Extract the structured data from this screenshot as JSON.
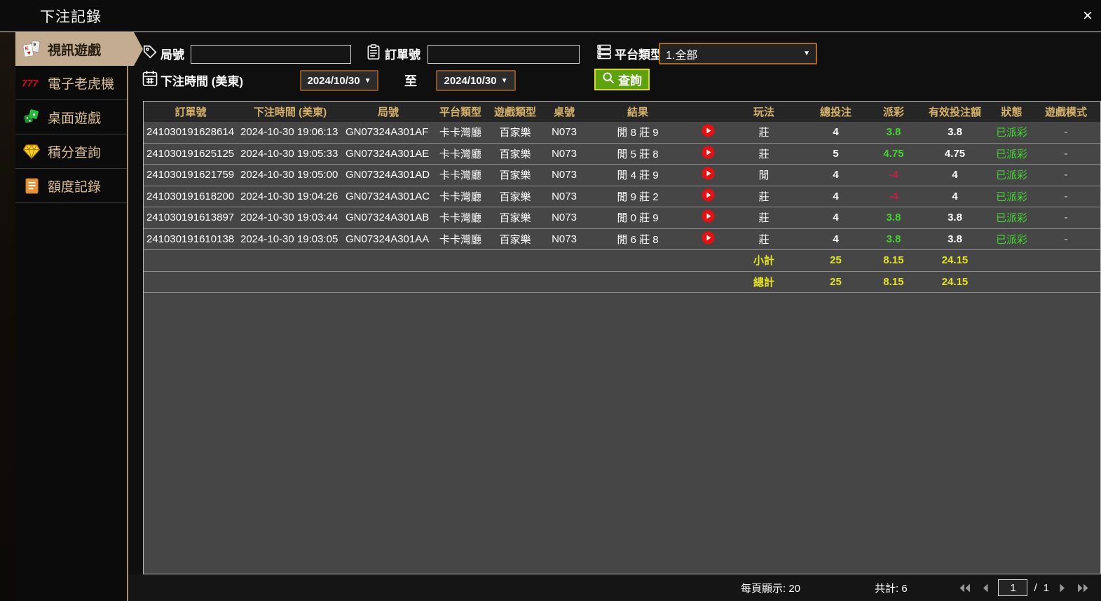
{
  "window": {
    "title": "下注記錄",
    "close_icon": "×"
  },
  "sidebar": {
    "items": [
      {
        "label": "視訊遊戲",
        "icon": "playing-cards-icon",
        "selected": true
      },
      {
        "label": "電子老虎機",
        "icon": "slot-777-icon",
        "selected": false
      },
      {
        "label": "桌面遊戲",
        "icon": "dice-icon",
        "selected": false
      },
      {
        "label": "積分查詢",
        "icon": "gem-icon",
        "selected": false
      },
      {
        "label": "額度記錄",
        "icon": "document-icon",
        "selected": false
      }
    ]
  },
  "filters": {
    "round_label": "局號",
    "order_label": "訂單號",
    "platform_label": "平台類型",
    "platform_value": "1.全部",
    "time_label": "下注時間 (美東)",
    "date_from": "2024/10/30",
    "date_to": "2024/10/30",
    "to_label": "至",
    "search_label": "查詢",
    "caret": "▼"
  },
  "table": {
    "columns": [
      "訂單號",
      "下注時間 (美東)",
      "局號",
      "平台類型",
      "遊戲類型",
      "桌號",
      "結果",
      "",
      "玩法",
      "總投注",
      "派彩",
      "有效投注額",
      "狀態",
      "遊戲模式"
    ],
    "rows": [
      {
        "order": "241030191628614",
        "time": "2024-10-30 19:06:13",
        "round": "GN07324A301AF",
        "platform": "卡卡灣廳",
        "game": "百家樂",
        "table_no": "N073",
        "result": "閒 8 莊 9",
        "play": "莊",
        "total_bet": "4",
        "payout": "3.8",
        "payout_type": "pos",
        "valid_bet": "3.8",
        "status": "已派彩",
        "mode": "-"
      },
      {
        "order": "241030191625125",
        "time": "2024-10-30 19:05:33",
        "round": "GN07324A301AE",
        "platform": "卡卡灣廳",
        "game": "百家樂",
        "table_no": "N073",
        "result": "閒 5 莊 8",
        "play": "莊",
        "total_bet": "5",
        "payout": "4.75",
        "payout_type": "pos",
        "valid_bet": "4.75",
        "status": "已派彩",
        "mode": "-"
      },
      {
        "order": "241030191621759",
        "time": "2024-10-30 19:05:00",
        "round": "GN07324A301AD",
        "platform": "卡卡灣廳",
        "game": "百家樂",
        "table_no": "N073",
        "result": "閒 4 莊 9",
        "play": "閒",
        "total_bet": "4",
        "payout": "-4",
        "payout_type": "neg",
        "valid_bet": "4",
        "status": "已派彩",
        "mode": "-"
      },
      {
        "order": "241030191618200",
        "time": "2024-10-30 19:04:26",
        "round": "GN07324A301AC",
        "platform": "卡卡灣廳",
        "game": "百家樂",
        "table_no": "N073",
        "result": "閒 9 莊 2",
        "play": "莊",
        "total_bet": "4",
        "payout": "-4",
        "payout_type": "neg",
        "valid_bet": "4",
        "status": "已派彩",
        "mode": "-"
      },
      {
        "order": "241030191613897",
        "time": "2024-10-30 19:03:44",
        "round": "GN07324A301AB",
        "platform": "卡卡灣廳",
        "game": "百家樂",
        "table_no": "N073",
        "result": "閒 0 莊 9",
        "play": "莊",
        "total_bet": "4",
        "payout": "3.8",
        "payout_type": "pos",
        "valid_bet": "3.8",
        "status": "已派彩",
        "mode": "-"
      },
      {
        "order": "241030191610138",
        "time": "2024-10-30 19:03:05",
        "round": "GN07324A301AA",
        "platform": "卡卡灣廳",
        "game": "百家樂",
        "table_no": "N073",
        "result": "閒 6 莊 8",
        "play": "莊",
        "total_bet": "4",
        "payout": "3.8",
        "payout_type": "pos",
        "valid_bet": "3.8",
        "status": "已派彩",
        "mode": "-"
      }
    ],
    "subtotal": {
      "label": "小計",
      "total_bet": "25",
      "payout": "8.15",
      "valid_bet": "24.15"
    },
    "total": {
      "label": "總計",
      "total_bet": "25",
      "payout": "8.15",
      "valid_bet": "24.15"
    }
  },
  "footer": {
    "per_page_label": "每頁顯示:",
    "per_page_value": "20",
    "total_label": "共計:",
    "total_value": "6",
    "page_current": "1",
    "page_separator": "/",
    "page_total": "1"
  },
  "colors": {
    "accent_gold": "#d6b26b",
    "positive_green": "#3fd62c",
    "negative_red": "#c81e3e",
    "total_yellow": "#e5e31f",
    "button_green": "#5da30d",
    "date_border_brown": "#8a5524",
    "selected_beige": "#c3ac90",
    "play_red": "#e80f0f"
  }
}
